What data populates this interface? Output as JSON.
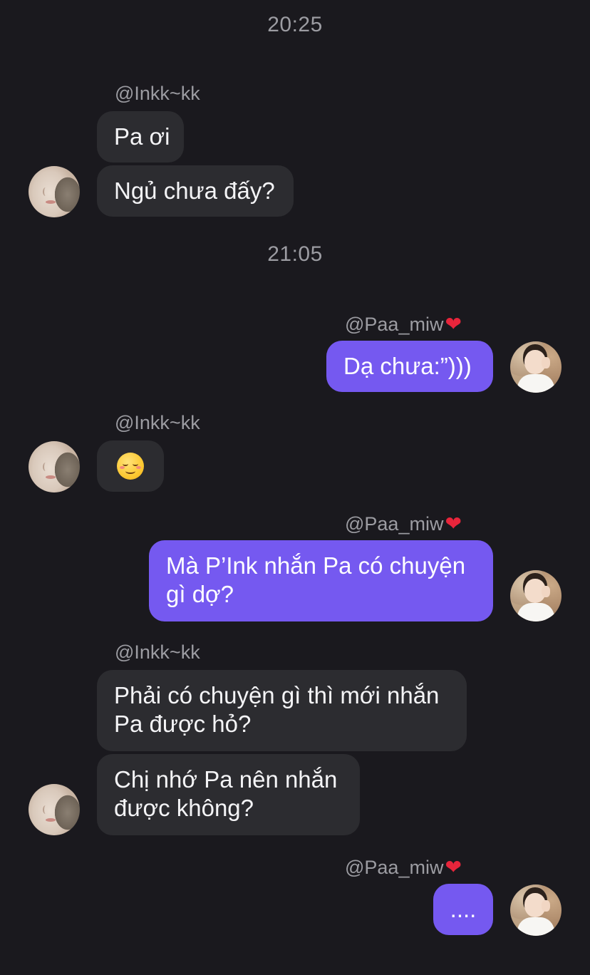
{
  "chat": {
    "timestamps": [
      "20:25",
      "21:05"
    ],
    "users": {
      "ink": "@Inkk~kk",
      "paa": "@Paa_miw",
      "paa_heart": "❤"
    },
    "messages": {
      "m1": "Pa ơi",
      "m2": "Ngủ chưa đấy?",
      "m3": "Dạ chưa:”)))",
      "m4": "☺️",
      "m5": "Mà P’Ink nhắn Pa có chuyện",
      "m5b": "gì dợ?",
      "m6": "Phải có chuyện gì thì mới nhắn",
      "m6b": "Pa được hỏ?",
      "m7": "Chị nhớ Pa nên nhắn",
      "m7b": "được không?",
      "m8": "...."
    }
  },
  "colors": {
    "background": "#1a191e",
    "incoming_bubble": "#2c2c30",
    "outgoing_bubble": "#7559f0",
    "meta_text": "#9c9ca2",
    "heart": "#e8253b"
  }
}
